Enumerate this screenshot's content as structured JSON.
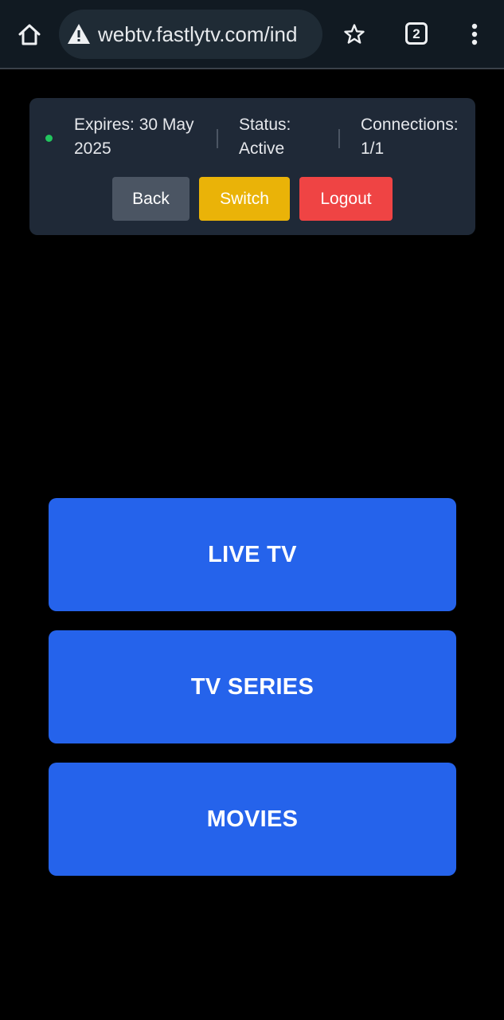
{
  "browser": {
    "url": "webtv.fastlytv.com/ind",
    "tab_count": "2",
    "icons": {
      "home": "home-icon",
      "warning": "not-secure-warning-icon",
      "bookmark": "star-icon",
      "menu": "more-vert-icon"
    }
  },
  "account": {
    "expires": "Expires: 30 May 2025",
    "status": "Status: Active",
    "connections": "Connections: 1/1",
    "status_color": "#22c55e"
  },
  "actions": {
    "back_label": "Back",
    "switch_label": "Switch",
    "logout_label": "Logout"
  },
  "categories": [
    {
      "label": "LIVE TV"
    },
    {
      "label": "TV SERIES"
    },
    {
      "label": "MOVIES"
    }
  ],
  "colors": {
    "background": "#000000",
    "card": "#1f2937",
    "category_blue": "#2563eb",
    "back_gray": "#4b5563",
    "switch_yellow": "#eab308",
    "logout_red": "#ef4444"
  }
}
